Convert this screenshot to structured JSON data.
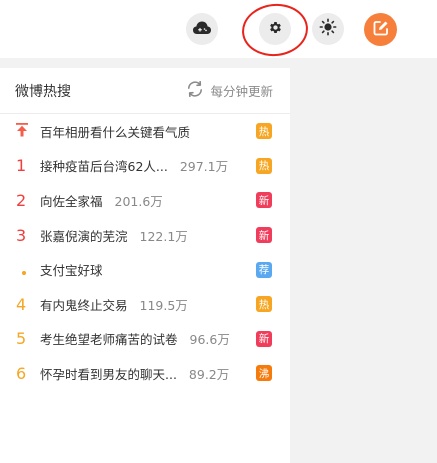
{
  "toolbar": {
    "game_icon": "cloud-game-icon",
    "settings_icon": "gear-icon",
    "theme_icon": "sun-icon",
    "compose_icon": "edit-icon",
    "compose_color": "#f6803b",
    "highlight_color": "#e8241d"
  },
  "hot_search": {
    "title": "微博热搜",
    "refresh_label": "每分钟更新",
    "items": [
      {
        "rank": "",
        "title": "百年相册看什么关键看气质",
        "count": "",
        "badge": "热",
        "badge_color": "#f6a623"
      },
      {
        "rank": "1",
        "title": "接种疫苗后台湾62人...",
        "count": "297.1万",
        "badge": "热",
        "badge_color": "#f6a623"
      },
      {
        "rank": "2",
        "title": "向佐全家福",
        "count": "201.6万",
        "badge": "新",
        "badge_color": "#f03d5b"
      },
      {
        "rank": "3",
        "title": "张嘉倪演的芜浣",
        "count": "122.1万",
        "badge": "新",
        "badge_color": "#f03d5b"
      },
      {
        "rank": "",
        "title": "支付宝好球",
        "count": "",
        "badge": "荐",
        "badge_color": "#5aa9f0"
      },
      {
        "rank": "4",
        "title": "有内鬼终止交易",
        "count": "119.5万",
        "badge": "热",
        "badge_color": "#f6a623"
      },
      {
        "rank": "5",
        "title": "考生绝望老师痛苦的试卷",
        "count": "96.6万",
        "badge": "新",
        "badge_color": "#f03d5b"
      },
      {
        "rank": "6",
        "title": "怀孕时看到男友的聊天...",
        "count": "89.2万",
        "badge": "沸",
        "badge_color": "#f57c0c"
      }
    ]
  }
}
